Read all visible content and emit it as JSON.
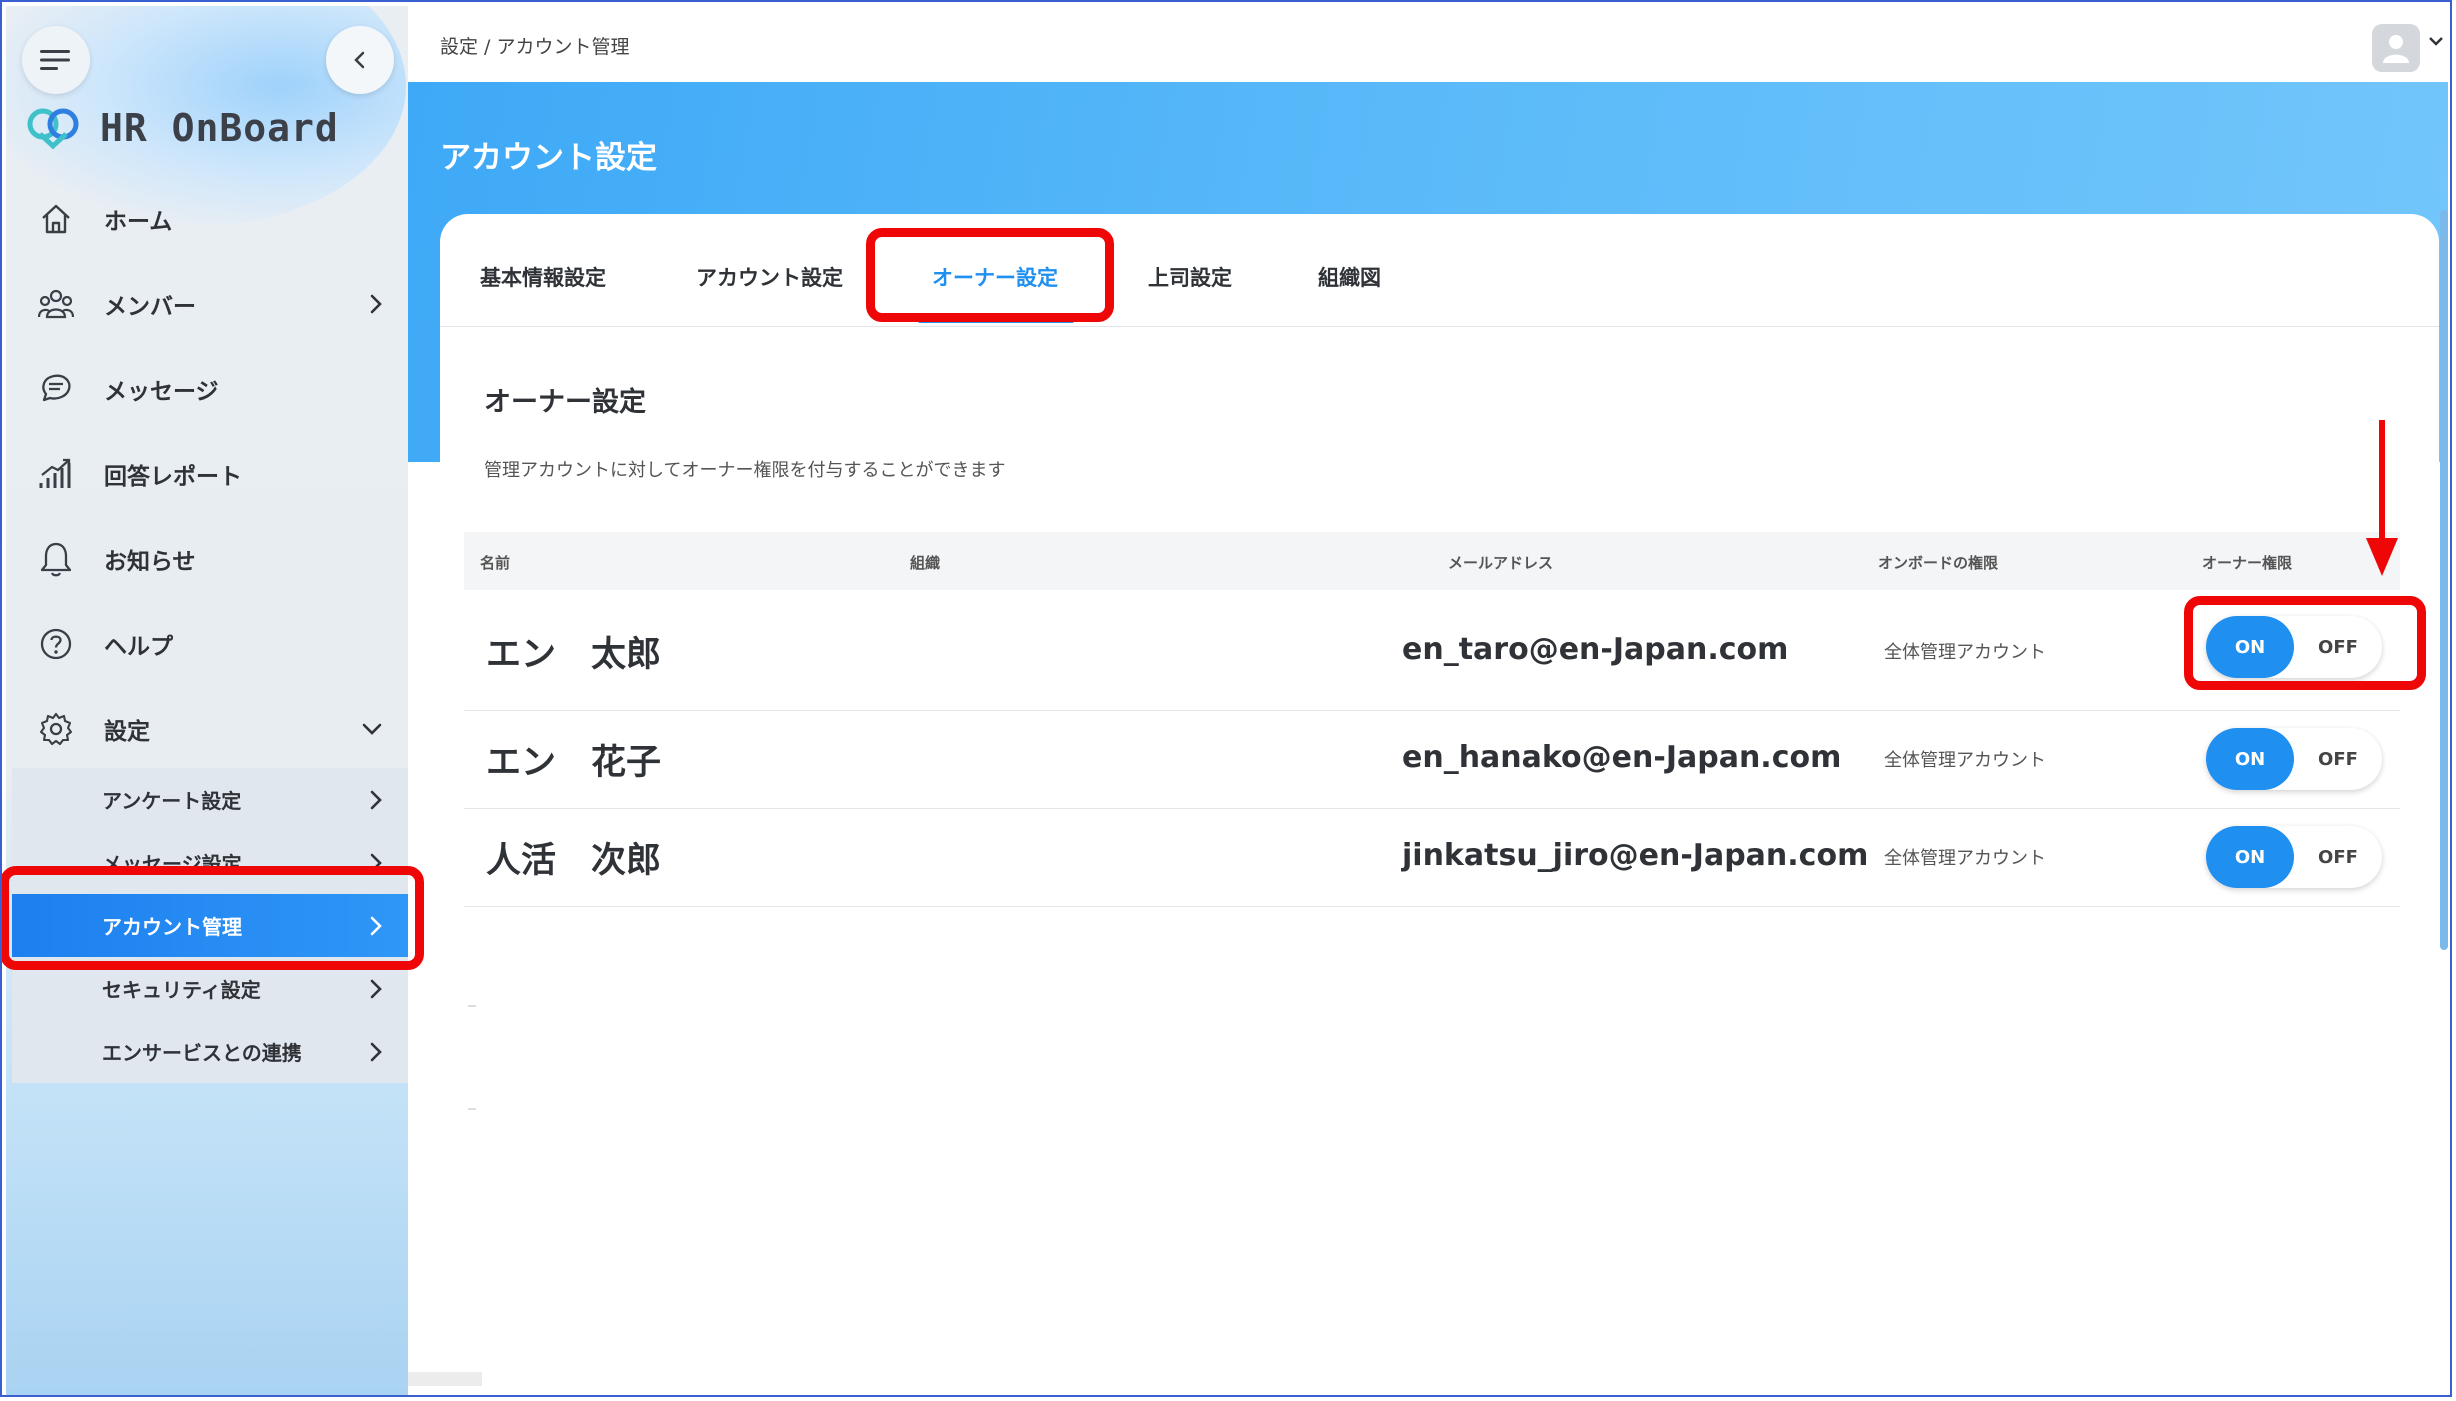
{
  "sidebar": {
    "logo_text": "HR OnBoard",
    "nav": [
      {
        "label": "ホーム",
        "icon": "home-icon"
      },
      {
        "label": "メンバー",
        "icon": "members-icon"
      },
      {
        "label": "メッセージ",
        "icon": "message-icon"
      },
      {
        "label": "回答レポート",
        "icon": "report-icon"
      },
      {
        "label": "お知らせ",
        "icon": "bell-icon"
      },
      {
        "label": "ヘルプ",
        "icon": "help-icon"
      },
      {
        "label": "設定",
        "icon": "gear-icon"
      }
    ],
    "settings_sub": [
      {
        "label": "アンケート設定"
      },
      {
        "label": "メッセージ設定"
      },
      {
        "label": "アカウント管理"
      },
      {
        "label": "セキュリティ設定"
      },
      {
        "label": "エンサービスとの連携"
      }
    ]
  },
  "breadcrumb": "設定 / アカウント管理",
  "page_title": "アカウント設定",
  "tabs": [
    {
      "label": "基本情報設定"
    },
    {
      "label": "アカウント設定"
    },
    {
      "label": "オーナー設定"
    },
    {
      "label": "上司設定"
    },
    {
      "label": "組織図"
    }
  ],
  "section": {
    "title": "オーナー設定",
    "description": "管理アカウントに対してオーナー権限を付与することができます"
  },
  "table": {
    "headers": [
      "名前",
      "組織",
      "メールアドレス",
      "オンボードの権限",
      "オーナー権限"
    ],
    "rows": [
      {
        "name": "エン　太郎",
        "org": "",
        "email": "en_taro@en-Japan.com",
        "permission": "全体管理アカウント",
        "on": "ON",
        "off": "OFF"
      },
      {
        "name": "エン　花子",
        "org": "",
        "email": "en_hanako@en-Japan.com",
        "permission": "全体管理アカウント",
        "on": "ON",
        "off": "OFF"
      },
      {
        "name": "人活　次郎",
        "org": "",
        "email": "jinkatsu_jiro@en-Japan.com",
        "permission": "全体管理アカウント",
        "on": "ON",
        "off": "OFF"
      }
    ]
  },
  "colors": {
    "accent": "#1f8ff0",
    "annotation": "#ef0707",
    "header_band": "#52b6f9"
  }
}
